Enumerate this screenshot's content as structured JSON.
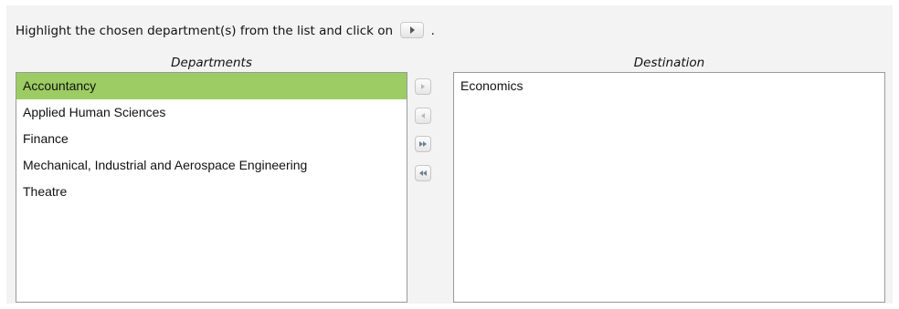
{
  "instruction": {
    "text": "Highlight the chosen department(s) from the list and click on",
    "button_icon": "move-right-icon",
    "trailing": "."
  },
  "departments": {
    "title": "Departments",
    "selected_index": 0,
    "items": [
      "Accountancy",
      "Applied Human Sciences",
      "Finance",
      "Mechanical, Industrial and Aerospace Engineering",
      "Theatre"
    ]
  },
  "destination": {
    "title": "Destination",
    "items": [
      "Economics"
    ]
  },
  "move_buttons": [
    {
      "icon": "move-selected-right-icon",
      "enabled": false
    },
    {
      "icon": "move-selected-left-icon",
      "enabled": false
    },
    {
      "icon": "move-all-right-icon",
      "enabled": true
    },
    {
      "icon": "move-all-left-icon",
      "enabled": true
    }
  ],
  "colors": {
    "selected_row": "#9ccc63",
    "panel_background": "#f3f3f3"
  }
}
